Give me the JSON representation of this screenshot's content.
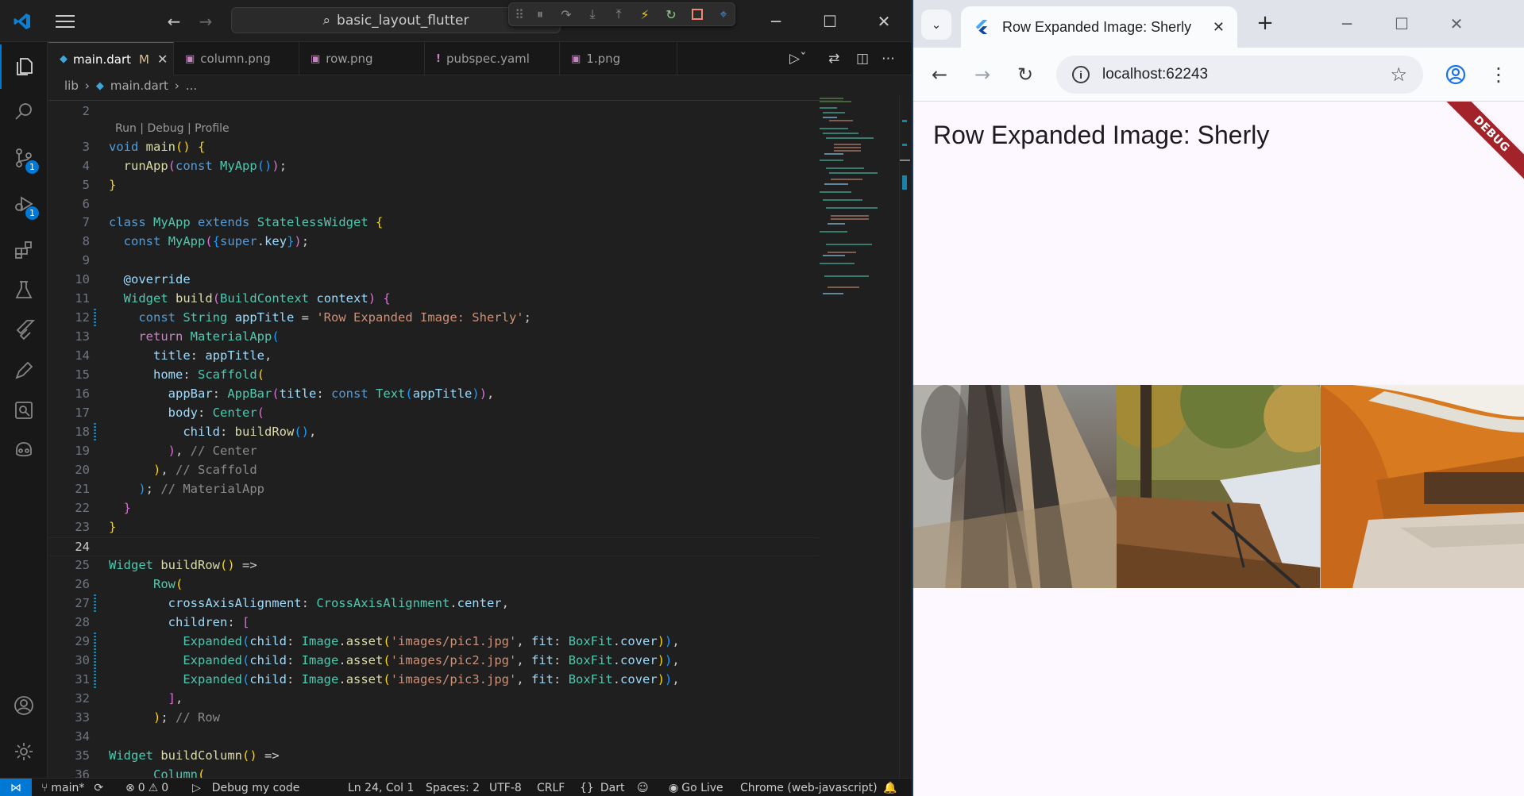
{
  "vscode": {
    "command_center": "basic_layout_flutter",
    "tabs": [
      {
        "label": "main.dart",
        "modified": "M",
        "active": true
      },
      {
        "label": "column.png"
      },
      {
        "label": "row.png"
      },
      {
        "label": "pubspec.yaml"
      },
      {
        "label": "1.png"
      }
    ],
    "breadcrumb": [
      "lib",
      "main.dart",
      "..."
    ],
    "codelens": "Run | Debug | Profile",
    "activity_badges": {
      "source_control": "1",
      "run_debug": "1"
    },
    "status": {
      "branch": "main*",
      "errors": "0",
      "warnings": "0",
      "debug_config": "Debug my code",
      "position": "Ln 24, Col 1",
      "spaces": "Spaces: 2",
      "encoding": "UTF-8",
      "eol": "CRLF",
      "language": "Dart",
      "go_live": "Go Live",
      "device": "Chrome (web-javascript)"
    }
  },
  "chrome": {
    "tab_title": "Row Expanded Image: Sherly",
    "url": "localhost:62243"
  },
  "app": {
    "title": "Row Expanded Image: Sherly",
    "debug_banner": "DEBUG",
    "images": [
      "images/pic1.jpg",
      "images/pic2.jpg",
      "images/pic3.jpg"
    ]
  }
}
